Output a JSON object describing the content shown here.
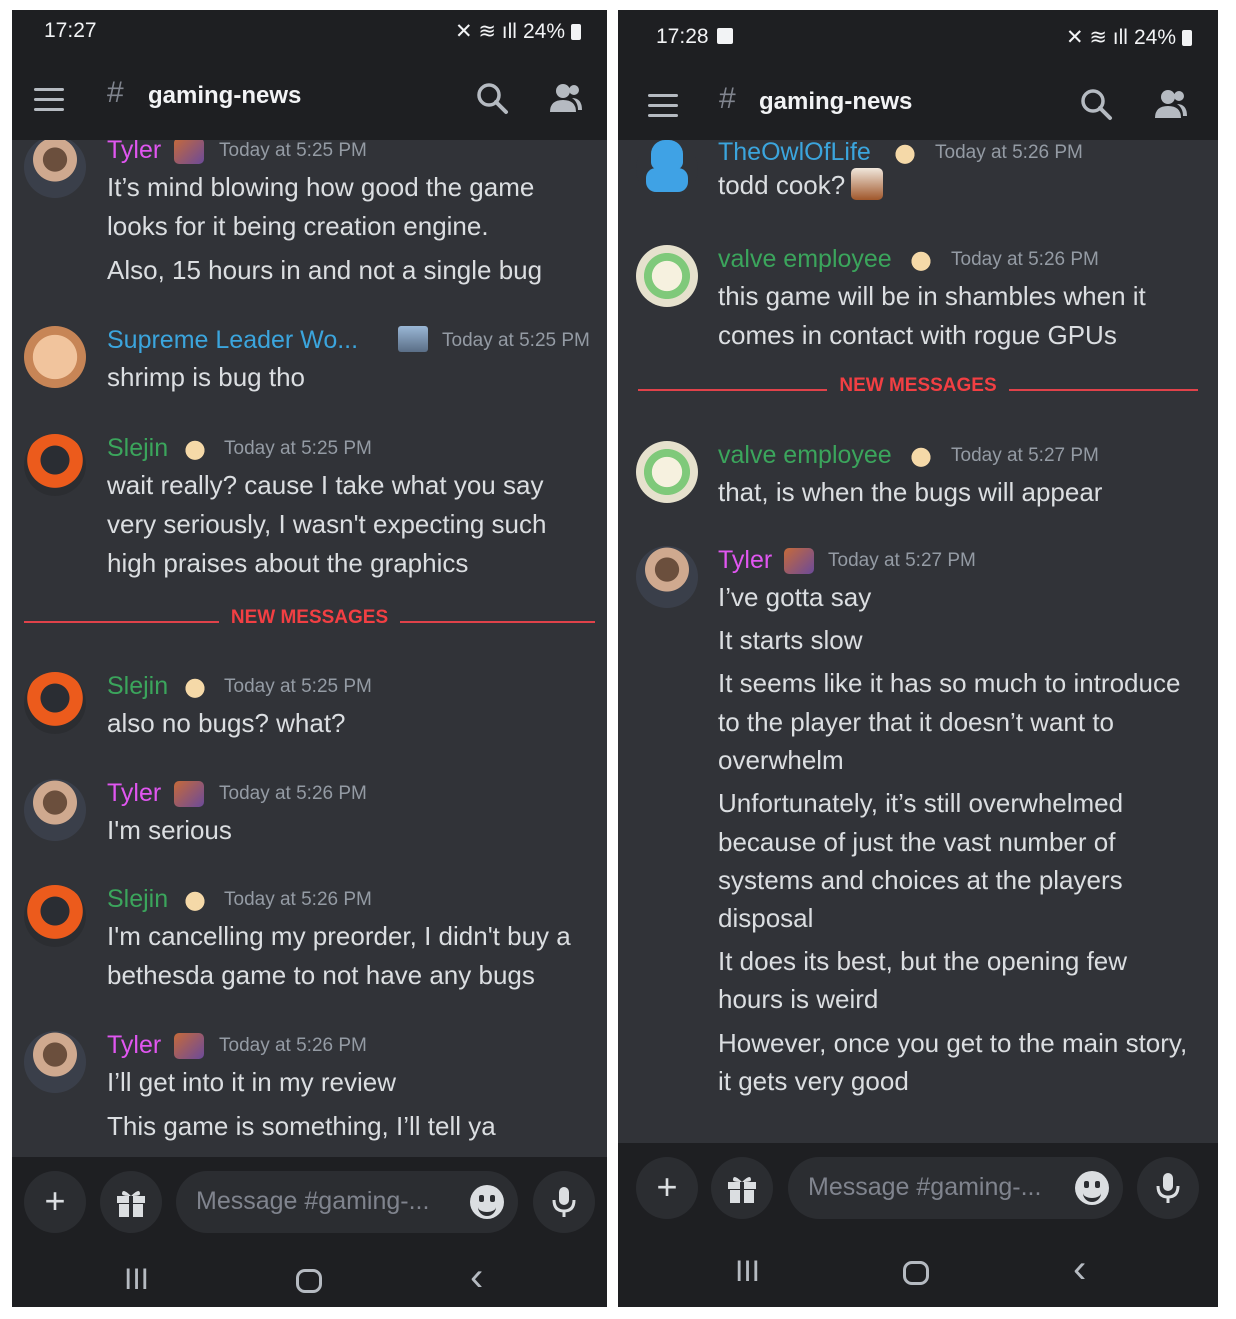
{
  "left": {
    "status": {
      "time": "17:27",
      "battery": "24%"
    },
    "header": {
      "channel": "gaming-news",
      "hash": "#"
    },
    "messages": [
      {
        "user": "Tyler",
        "time": "Today at 5:25 PM",
        "lines": [
          "It’s mind blowing how good the game",
          "looks for it being creation engine.",
          "Also, 15 hours in and not a single bug"
        ]
      },
      {
        "user": "Supreme Leader Wo...",
        "time": "Today at 5:25 PM",
        "lines": [
          "shrimp is bug tho"
        ]
      },
      {
        "user": "Slejin",
        "time": "Today at 5:25 PM",
        "lines": [
          "wait really? cause I take what you say",
          "very seriously, I wasn't expecting such",
          "high praises about the graphics"
        ]
      },
      {
        "user": "Slejin",
        "time": "Today at 5:25 PM",
        "lines": [
          "also no bugs? what?"
        ]
      },
      {
        "user": "Tyler",
        "time": "Today at 5:26 PM",
        "lines": [
          "I'm serious"
        ]
      },
      {
        "user": "Slejin",
        "time": "Today at 5:26 PM",
        "lines": [
          "I'm cancelling my preorder, I didn't buy a",
          "bethesda game to not have any bugs"
        ]
      },
      {
        "user": "Tyler",
        "time": "Today at 5:26 PM",
        "lines": [
          "I’ll get into it in my review",
          "This game is something, I’ll tell ya"
        ]
      }
    ],
    "new_messages": "NEW MESSAGES",
    "input": {
      "placeholder": "Message #gaming-..."
    }
  },
  "right": {
    "status": {
      "time": "17:28",
      "battery": "24%"
    },
    "header": {
      "channel": "gaming-news",
      "hash": "#"
    },
    "messages": [
      {
        "user": "TheOwlOfLife",
        "time": "Today at 5:26 PM",
        "lines": [
          "todd cook?"
        ]
      },
      {
        "user": "valve employee",
        "time": "Today at 5:26 PM",
        "lines": [
          "this game will be in shambles when it",
          "comes in contact with rogue GPUs"
        ]
      },
      {
        "user": "valve employee",
        "time": "Today at 5:27 PM",
        "lines": [
          "that, is when the bugs will appear"
        ]
      },
      {
        "user": "Tyler",
        "time": "Today at 5:27 PM",
        "lines": [
          "I’ve gotta say",
          "It starts slow",
          "It seems like it has so much to introduce",
          "to the player that it doesn’t want to",
          "overwhelm",
          "Unfortunately, it’s still overwhelmed",
          "because of just the vast number of",
          "systems and choices at the players",
          "disposal",
          "It does its best, but the opening few",
          "hours is weird",
          "However, once you get to the main story,",
          "it gets very good"
        ]
      }
    ],
    "new_messages": "NEW MESSAGES",
    "input": {
      "placeholder": "Message #gaming-..."
    }
  },
  "icons": {
    "plus": "+",
    "back": "‹",
    "recents": "III",
    "hand": "hand-emoji",
    "tyler_badge": "tyler-role-icon",
    "status": "mute-wifi-signal-icons"
  }
}
